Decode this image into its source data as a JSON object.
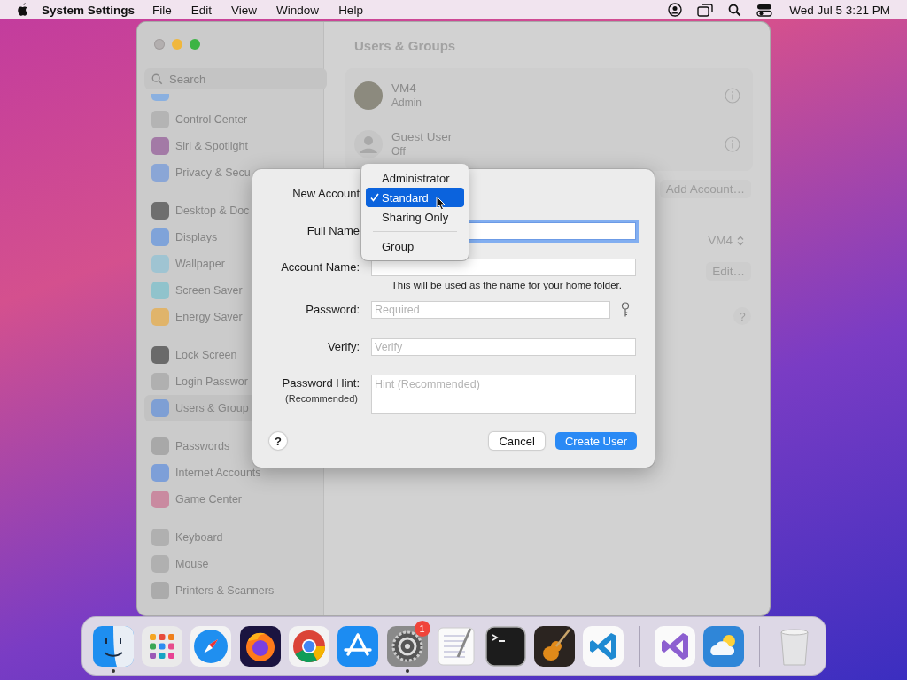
{
  "menu_bar": {
    "app": "System Settings",
    "menus": [
      "File",
      "Edit",
      "View",
      "Window",
      "Help"
    ],
    "clock": "Wed Jul 5  3:21 PM"
  },
  "window": {
    "title": "Users & Groups"
  },
  "sidebar": {
    "search": {
      "placeholder": "Search"
    },
    "groups": [
      {
        "items": [
          {
            "label": "Control Center",
            "color": "#b4b4b4",
            "selected": false
          },
          {
            "label": "Siri & Spotlight",
            "color": "#a37aa6",
            "selected": false
          },
          {
            "label": "Privacy & Secu",
            "color": "#8aa6d6",
            "selected": false
          }
        ]
      },
      {
        "items": [
          {
            "label": "Desktop & Doc",
            "color": "#6e6e6e",
            "selected": false
          },
          {
            "label": "Displays",
            "color": "#7fa3d9",
            "selected": false
          },
          {
            "label": "Wallpaper",
            "color": "#9fc4d2",
            "selected": false
          },
          {
            "label": "Screen Saver",
            "color": "#90c3cc",
            "selected": false
          },
          {
            "label": "Energy Saver",
            "color": "#e0b46a",
            "selected": false
          }
        ]
      },
      {
        "items": [
          {
            "label": "Lock Screen",
            "color": "#6a6a6a",
            "selected": false
          },
          {
            "label": "Login Passwor",
            "color": "#b0b0b0",
            "selected": false
          },
          {
            "label": "Users & Group",
            "color": "#7e9fd4",
            "selected": true
          }
        ]
      },
      {
        "items": [
          {
            "label": "Passwords",
            "color": "#a8a8a8",
            "selected": false
          },
          {
            "label": "Internet Accounts",
            "color": "#7d9fd8",
            "selected": false
          },
          {
            "label": "Game Center",
            "color": "#c98aa0",
            "selected": false
          }
        ]
      },
      {
        "items": [
          {
            "label": "Keyboard",
            "color": "#b0b0b0",
            "selected": false
          },
          {
            "label": "Mouse",
            "color": "#b0b0b0",
            "selected": false
          },
          {
            "label": "Printers & Scanners",
            "color": "#ababab",
            "selected": false
          }
        ]
      }
    ]
  },
  "users": [
    {
      "name": "VM4",
      "role": "Admin",
      "kind": "photo"
    },
    {
      "name": "Guest User",
      "role": "Off",
      "kind": "guest"
    }
  ],
  "add_account_button": "Add Account…",
  "auto_login_select": "VM4",
  "edit_button": "Edit…",
  "help_button": "?",
  "dialog": {
    "type_label": "New Account",
    "fields": [
      {
        "label": "Full Name",
        "kind": "text",
        "focused": true
      },
      {
        "label": "Account Name:",
        "kind": "text",
        "focused": false,
        "note": "This will be used as the name for your home folder."
      },
      {
        "label": "Password:",
        "kind": "password",
        "placeholder": "Required",
        "focused": false
      },
      {
        "label": "Verify:",
        "kind": "text",
        "placeholder": "Verify",
        "focused": false
      },
      {
        "label": "Password Hint:",
        "sublabel": "(Recommended)",
        "kind": "multiline",
        "placeholder": "Hint (Recommended)",
        "focused": false
      }
    ],
    "help_button": "?",
    "cancel_button": "Cancel",
    "create_button": "Create User"
  },
  "type_menu": {
    "sections": [
      {
        "items": [
          {
            "label": "Administrator",
            "selected": false
          },
          {
            "label": "Standard",
            "selected": true
          },
          {
            "label": "Sharing Only",
            "selected": false
          }
        ]
      },
      {
        "items": [
          {
            "label": "Group",
            "selected": false
          }
        ]
      }
    ]
  },
  "dock": [
    {
      "kind": "finder",
      "running": true
    },
    {
      "kind": "launchpad",
      "running": false
    },
    {
      "kind": "safari",
      "running": false
    },
    {
      "kind": "firefox",
      "running": false
    },
    {
      "kind": "chrome",
      "running": false
    },
    {
      "kind": "appstore",
      "running": false
    },
    {
      "kind": "settings",
      "running": true,
      "badge": "1"
    },
    {
      "kind": "textedit",
      "running": false
    },
    {
      "kind": "terminal",
      "running": false
    },
    {
      "kind": "garageband",
      "running": false
    },
    {
      "kind": "vscode",
      "running": false
    },
    {
      "kind": "divider"
    },
    {
      "kind": "vs",
      "running": false
    },
    {
      "kind": "weather",
      "running": false
    },
    {
      "kind": "divider"
    },
    {
      "kind": "trash",
      "running": false
    }
  ]
}
